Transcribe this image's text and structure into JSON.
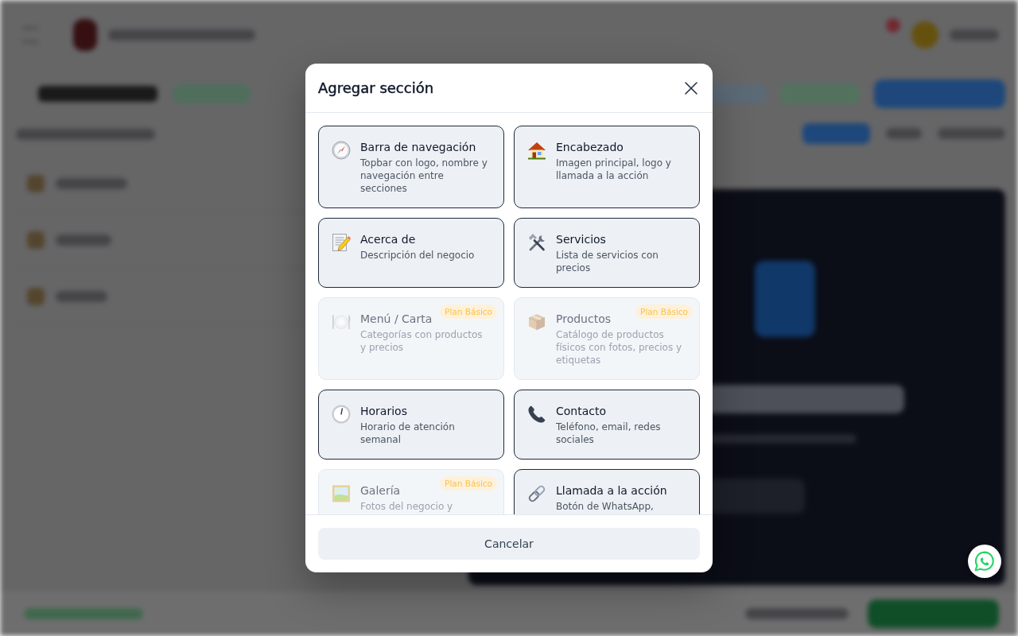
{
  "dialog": {
    "title": "Agregar sección",
    "sections": [
      {
        "title": "Barra de navegación",
        "description": "Topbar con logo, nombre y navegación entre secciones",
        "disabled": false
      },
      {
        "title": "Encabezado",
        "description": "Imagen principal, logo y llamada a la acción",
        "disabled": false
      },
      {
        "title": "Acerca de",
        "description": "Descripción del negocio",
        "disabled": false
      },
      {
        "title": "Servicios",
        "description": "Lista de servicios con precios",
        "disabled": false
      },
      {
        "title": "Menú / Carta",
        "description": "Categorías con productos y precios",
        "disabled": true,
        "badge": "Plan Básico"
      },
      {
        "title": "Productos",
        "description": "Catálogo de productos físicos con fotos, precios y etiquetas",
        "disabled": true,
        "badge": "Plan Básico"
      },
      {
        "title": "Horarios",
        "description": "Horario de atención semanal",
        "disabled": false
      },
      {
        "title": "Contacto",
        "description": "Teléfono, email, redes sociales",
        "disabled": false
      },
      {
        "title": "Galería",
        "description": "Fotos del negocio y",
        "disabled": true,
        "badge": "Plan Básico"
      },
      {
        "title": "Llamada a la acción",
        "description": "Botón de WhatsApp,",
        "disabled": false
      }
    ],
    "cancel_button": "Cancelar"
  }
}
